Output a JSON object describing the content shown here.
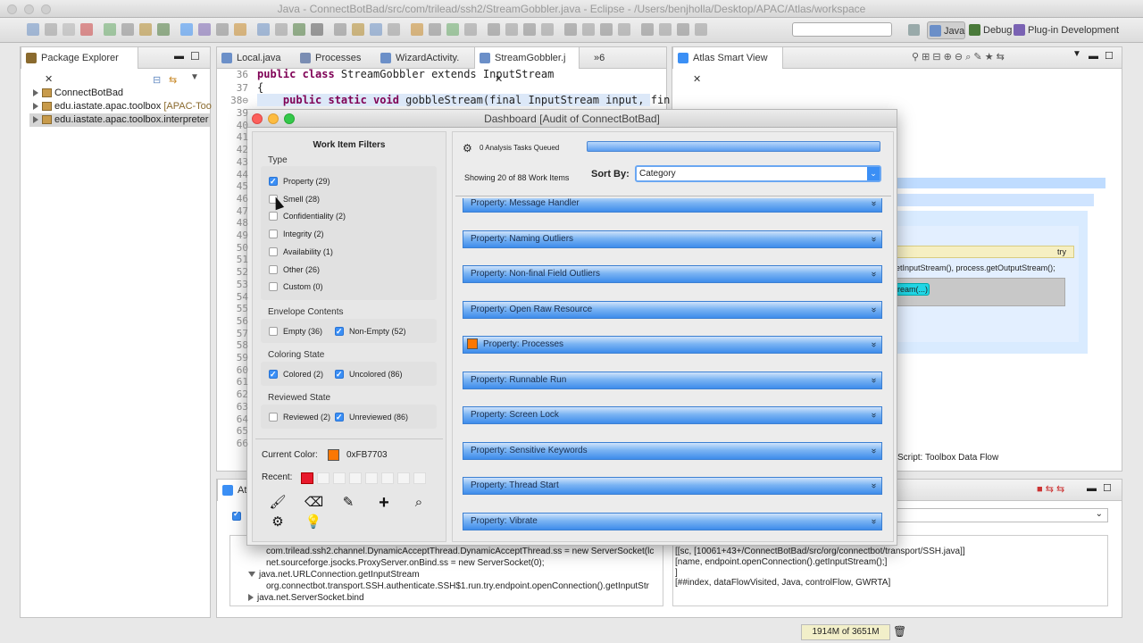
{
  "window": {
    "title": "Java - ConnectBotBad/src/com/trilead/ssh2/StreamGobbler.java - Eclipse - /Users/benjholla/Desktop/APAC/Atlas/workspace"
  },
  "perspectives": {
    "java": "Java",
    "debug": "Debug",
    "plugin": "Plug-in Development"
  },
  "package_explorer": {
    "tab_label": "Package Explorer",
    "items": [
      {
        "label": "ConnectBotBad",
        "suffix": ""
      },
      {
        "label": "edu.iastate.apac.toolbox",
        "suffix": "[APAC-Too"
      },
      {
        "label": "edu.iastate.apac.toolbox.interpreter",
        "suffix": ""
      }
    ]
  },
  "editor": {
    "tabs": [
      "Local.java",
      "Processes",
      "WizardActivity.",
      "StreamGobbler.j",
      "»6"
    ],
    "lines": [
      {
        "num": "36",
        "kw": "public class",
        "rest": " StreamGobbler extends InputStream"
      },
      {
        "num": "37",
        "kw": "",
        "rest": "{"
      },
      {
        "num": "38⊖",
        "kw": "    public static void",
        "rest": " gobbleStream(final InputStream input, fin"
      }
    ],
    "gutter_numbers": [
      "39",
      "40",
      "41",
      "42",
      "43",
      "44",
      "45",
      "46",
      "47",
      "48",
      "49",
      "50",
      "51",
      "52",
      "53",
      "54",
      "55",
      "56",
      "57",
      "58",
      "59",
      "60",
      "61",
      "62",
      "63",
      "64",
      "65",
      "66"
    ]
  },
  "atlas_smart_view": {
    "tab_label": "Atlas Smart View",
    "try_label": "try",
    "code_snippet": "etInputStream(), process.getOutputStream();",
    "node_label": "ream(...)",
    "script_label": "Script: Toolbox Data Flow"
  },
  "dashboard": {
    "title": "Dashboard [Audit of ConnectBotBad]",
    "filters_title": "Work Item Filters",
    "type_heading": "Type",
    "type_items": [
      {
        "label": "Property (29)",
        "checked": true
      },
      {
        "label": "Smell (28)",
        "checked": false
      },
      {
        "label": "Confidentiality (2)",
        "checked": false
      },
      {
        "label": "Integrity (2)",
        "checked": false
      },
      {
        "label": "Availability (1)",
        "checked": false
      },
      {
        "label": "Other (26)",
        "checked": false
      },
      {
        "label": "Custom (0)",
        "checked": false
      }
    ],
    "envelope_heading": "Envelope Contents",
    "envelope_items": [
      {
        "label": "Empty (36)",
        "checked": false
      },
      {
        "label": "Non-Empty (52)",
        "checked": true
      }
    ],
    "coloring_heading": "Coloring State",
    "coloring_items": [
      {
        "label": "Colored (2)",
        "checked": true
      },
      {
        "label": "Uncolored (86)",
        "checked": true
      }
    ],
    "reviewed_heading": "Reviewed State",
    "reviewed_items": [
      {
        "label": "Reviewed (2)",
        "checked": false
      },
      {
        "label": "Unreviewed (86)",
        "checked": true
      }
    ],
    "current_color_label": "Current Color:",
    "current_color_value": "0xFB7703",
    "current_color_hex": "#FB7703",
    "recent_label": "Recent:",
    "recent_first_color": "#e8192c",
    "tasks_queued": "0 Analysis Tasks Queued",
    "showing": "Showing 20 of 88 Work Items",
    "sort_by_label": "Sort By:",
    "sort_by_value": "Category",
    "categories": [
      "Property: Message Handler",
      "Property: Naming Outliers",
      "Property: Non-final Field Outliers",
      "Property: Open Raw Resource",
      "Property: Processes",
      "Property: Runnable Run",
      "Property: Screen Lock",
      "Property: Sensitive Keywords",
      "Property: Thread Start",
      "Property: Vibrate"
    ]
  },
  "bottom": {
    "tab_label": "Atl",
    "left_lines": [
      "com.trilead.ssh2.channel.DynamicAcceptThread.DynamicAcceptThread.ss = new ServerSocket(lc",
      "net.sourceforge.jsocks.ProxyServer.onBind.ss = new ServerSocket(0);",
      "java.net.URLConnection.getInputStream",
      "org.connectbot.transport.SSH.authenticate.SSH$1.run.try.endpoint.openConnection().getInputStr",
      "java.net.ServerSocket.bind"
    ],
    "right_lines": [
      "[[sc, [10061+43+/ConnectBotBad/src/org/connectbot/transport/SSH.java]]",
      " [name, endpoint.openConnection().getInputStream();]",
      "]",
      "[##index, dataFlowVisited, Java, controlFlow, GWRTA]"
    ],
    "memory": "1914M of 3651M"
  }
}
